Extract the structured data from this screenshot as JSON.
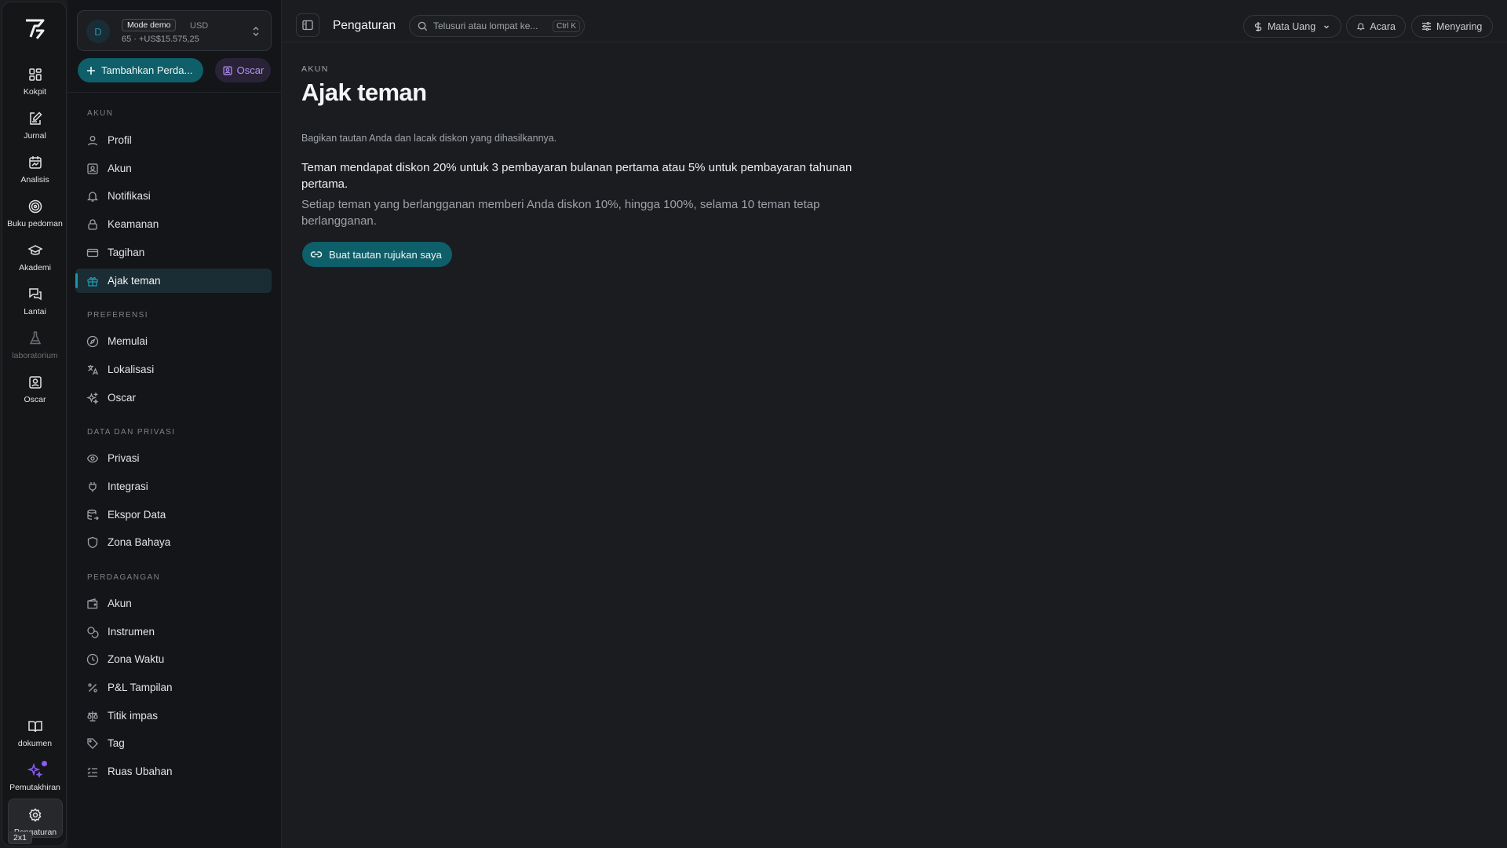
{
  "rail": {
    "items": [
      {
        "label": "Kokpit",
        "icon": "dashboard-grid-icon"
      },
      {
        "label": "Jurnal",
        "icon": "journal-edit-icon"
      },
      {
        "label": "Analisis",
        "icon": "calendar-chart-icon"
      },
      {
        "label": "Buku pedoman",
        "icon": "target-icon"
      },
      {
        "label": "Akademi",
        "icon": "graduation-cap-icon"
      },
      {
        "label": "Lantai",
        "icon": "chat-bubbles-icon"
      },
      {
        "label": "laboratorium",
        "icon": "flask-icon"
      },
      {
        "label": "Oscar",
        "icon": "contact-card-icon"
      }
    ],
    "bottom": [
      {
        "label": "dokumen",
        "icon": "book-open-icon"
      },
      {
        "label": "Pemutakhiran",
        "icon": "sparkles-icon"
      },
      {
        "label": "Pengaturan",
        "icon": "gear-icon"
      }
    ],
    "zoom_badge": "2x1"
  },
  "account": {
    "avatar_letter": "D",
    "mode": "Mode demo",
    "currency": "USD",
    "summary": "65 · +US$15.575,25"
  },
  "actions": {
    "add_label": "Tambahkan Perda...",
    "oscar_label": "Oscar"
  },
  "sidebar": {
    "sections": [
      {
        "title": "AKUN",
        "items": [
          "Profil",
          "Akun",
          "Notifikasi",
          "Keamanan",
          "Tagihan",
          "Ajak teman"
        ]
      },
      {
        "title": "PREFERENSI",
        "items": [
          "Memulai",
          "Lokalisasi",
          "Oscar"
        ]
      },
      {
        "title": "DATA DAN PRIVASI",
        "items": [
          "Privasi",
          "Integrasi",
          "Ekspor Data",
          "Zona Bahaya"
        ]
      },
      {
        "title": "PERDAGANGAN",
        "items": [
          "Akun",
          "Instrumen",
          "Zona Waktu",
          "P&L Tampilan",
          "Titik impas",
          "Tag",
          "Ruas Ubahan"
        ]
      }
    ],
    "active": "Ajak teman"
  },
  "topbar": {
    "title": "Pengaturan",
    "search_placeholder": "Telusuri atau lompat ke...",
    "search_shortcut": "Ctrl K",
    "currency_label": "Mata Uang",
    "events_label": "Acara",
    "filter_label": "Menyaring"
  },
  "main": {
    "eyebrow": "AKUN",
    "title": "Ajak teman",
    "description": "Bagikan tautan Anda dan lacak diskon yang dihasilkannya.",
    "friend_offer": "Teman mendapat diskon 20% untuk 3 pembayaran bulanan pertama atau 5% untuk pembayaran tahunan pertama.",
    "your_reward": "Setiap teman yang berlangganan memberi Anda diskon 10%, hingga 100%, selama 10 teman tetap berlangganan.",
    "cta_label": "Buat tautan rujukan saya"
  },
  "colors": {
    "accent": "#0e5f69",
    "accent_bright": "#1497a8",
    "oscar_purple": "#b393f5",
    "background": "#1a1c1f"
  }
}
